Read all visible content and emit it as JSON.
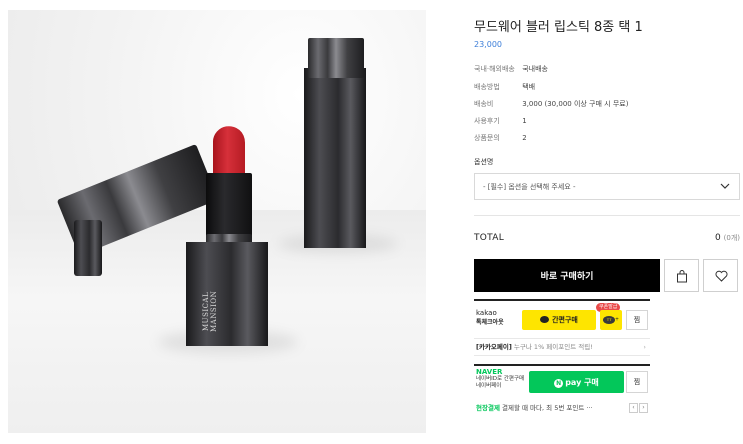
{
  "product": {
    "title": "무드웨어 블러 립스틱 8종 택 1",
    "price": "23,000",
    "image_logo": "MUSICAL MANSION"
  },
  "specs": [
    {
      "key": "국내·해외배송",
      "value": "국내배송"
    },
    {
      "key": "배송방법",
      "value": "택배"
    },
    {
      "key": "배송비",
      "value": "3,000 (30,000 이상 구매 시 무료)"
    },
    {
      "key": "사용후기",
      "value": "1"
    },
    {
      "key": "상품문의",
      "value": "2"
    }
  ],
  "option": {
    "label": "옵션명",
    "placeholder": "- [필수] 옵션을 선택해 주세요 -"
  },
  "total": {
    "label": "TOTAL",
    "value": "0",
    "count": "(0개)"
  },
  "actions": {
    "buy_now": "바로 구매하기",
    "cart_icon": "shopping-bag-icon",
    "wish_icon": "heart-icon"
  },
  "kakao": {
    "brand_line1": "kakao",
    "brand_line2": "톡체크아웃",
    "pay_label": "간편구매",
    "coupon_tag": "쿠폰발급",
    "talk_label": "+",
    "wish_label": "찜"
  },
  "kakao_promo": {
    "tag": "[카카오페이]",
    "text": "누구나 1% 페이포인트 적립!",
    "arrow": "›"
  },
  "naver": {
    "logo": "NAVER",
    "line1": "네이버ID로 간편구매",
    "line2": "네이버페이",
    "pay_label": "pay 구매",
    "n_mark": "N",
    "wish_label": "찜"
  },
  "onsite": {
    "tag": "현장결제",
    "text": "결제할 때 마다, 최 5번 포인트 ···",
    "prev": "‹",
    "next": "›"
  },
  "colors": {
    "price": "#3d7ed8",
    "buy_button": "#000000",
    "kakao_yellow": "#fee500",
    "naver_green": "#03c75a",
    "coupon_red": "#e94a4a"
  }
}
